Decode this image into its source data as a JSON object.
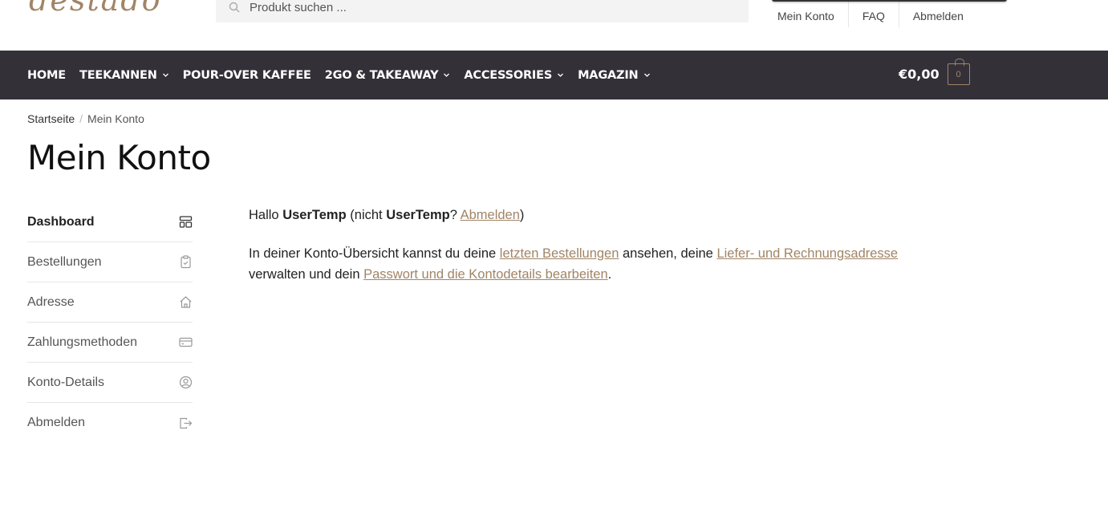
{
  "header": {
    "logo_text": "destado",
    "search_placeholder": "Produkt suchen ...",
    "top_menu": [
      "Mein Konto",
      "FAQ",
      "Abmelden"
    ]
  },
  "nav": {
    "items": [
      {
        "label": "HOME",
        "dropdown": false
      },
      {
        "label": "TEEKANNEN",
        "dropdown": true
      },
      {
        "label": "POUR-OVER KAFFEE",
        "dropdown": false
      },
      {
        "label": "2GO & TAKEAWAY",
        "dropdown": true
      },
      {
        "label": "ACCESSORIES",
        "dropdown": true
      },
      {
        "label": "MAGAZIN",
        "dropdown": true
      }
    ],
    "cart_amount": "€0,00",
    "cart_count": "0"
  },
  "breadcrumb": {
    "home": "Startseite",
    "separator": "/",
    "current": "Mein Konto"
  },
  "page_title": "Mein Konto",
  "sidebar": {
    "items": [
      {
        "label": "Dashboard",
        "icon": "dashboard-icon"
      },
      {
        "label": "Bestellungen",
        "icon": "clipboard-icon"
      },
      {
        "label": "Adresse",
        "icon": "home-icon"
      },
      {
        "label": "Zahlungsmethoden",
        "icon": "credit-card-icon"
      },
      {
        "label": "Konto-Details",
        "icon": "user-circle-icon"
      },
      {
        "label": "Abmelden",
        "icon": "logout-icon"
      }
    ]
  },
  "content": {
    "greeting_prefix": "Hallo",
    "username": "UserTemp",
    "not_prefix": "(nicht",
    "not_username": "UserTemp",
    "not_question": "?",
    "logout_link": "Abmelden",
    "close_paren": ")",
    "intro_1": "In deiner Konto-Übersicht kannst du deine",
    "orders_link": "letzten Bestellungen",
    "intro_2": "ansehen, deine",
    "address_link": "Liefer- und Rechnungsadresse",
    "intro_3": "verwalten und dein",
    "account_link": "Passwort und die Kontodetails bearbeiten",
    "intro_end": "."
  },
  "colors": {
    "accent": "#a08566",
    "navbar": "#333038"
  }
}
